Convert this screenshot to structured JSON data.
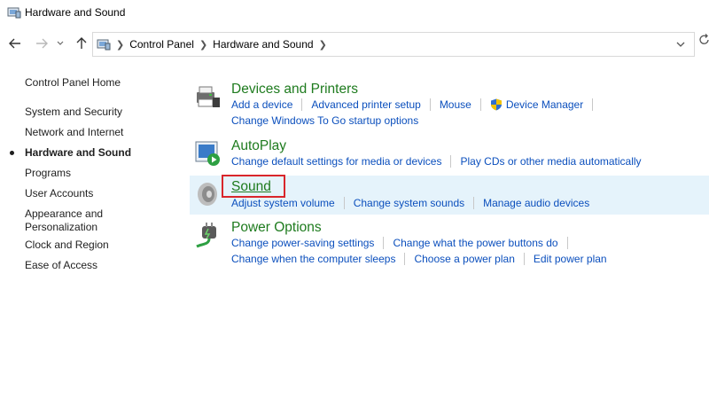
{
  "window": {
    "title": "Hardware and Sound"
  },
  "address_bar": {
    "breadcrumbs": [
      "Control Panel",
      "Hardware and Sound"
    ]
  },
  "sidebar": {
    "items": [
      {
        "label": "Control Panel Home"
      },
      {
        "label": "System and Security"
      },
      {
        "label": "Network and Internet"
      },
      {
        "label": "Hardware and Sound",
        "current": true
      },
      {
        "label": "Programs"
      },
      {
        "label": "User Accounts"
      },
      {
        "label": "Appearance and Personalization"
      },
      {
        "label": "Clock and Region"
      },
      {
        "label": "Ease of Access"
      }
    ]
  },
  "categories": [
    {
      "title": "Devices and Printers",
      "icon": "printer-icon",
      "rows": [
        [
          "Add a device",
          "Advanced printer setup",
          "Mouse",
          "Device Manager"
        ],
        [
          "Change Windows To Go startup options"
        ]
      ]
    },
    {
      "title": "AutoPlay",
      "icon": "autoplay-icon",
      "rows": [
        [
          "Change default settings for media or devices",
          "Play CDs or other media automatically"
        ]
      ]
    },
    {
      "title": "Sound",
      "icon": "speaker-icon",
      "rows": [
        [
          "Adjust system volume",
          "Change system sounds",
          "Manage audio devices"
        ]
      ]
    },
    {
      "title": "Power Options",
      "icon": "power-plug-icon",
      "rows": [
        [
          "Change power-saving settings",
          "Change what the power buttons do"
        ],
        [
          "Change when the computer sleeps",
          "Choose a power plan",
          "Edit power plan"
        ]
      ]
    }
  ],
  "colors": {
    "category_title": "#1e7b1e",
    "link": "#0b4fbd",
    "highlight_row": "#e5f3fb",
    "focus_outline": "#d9262b"
  }
}
